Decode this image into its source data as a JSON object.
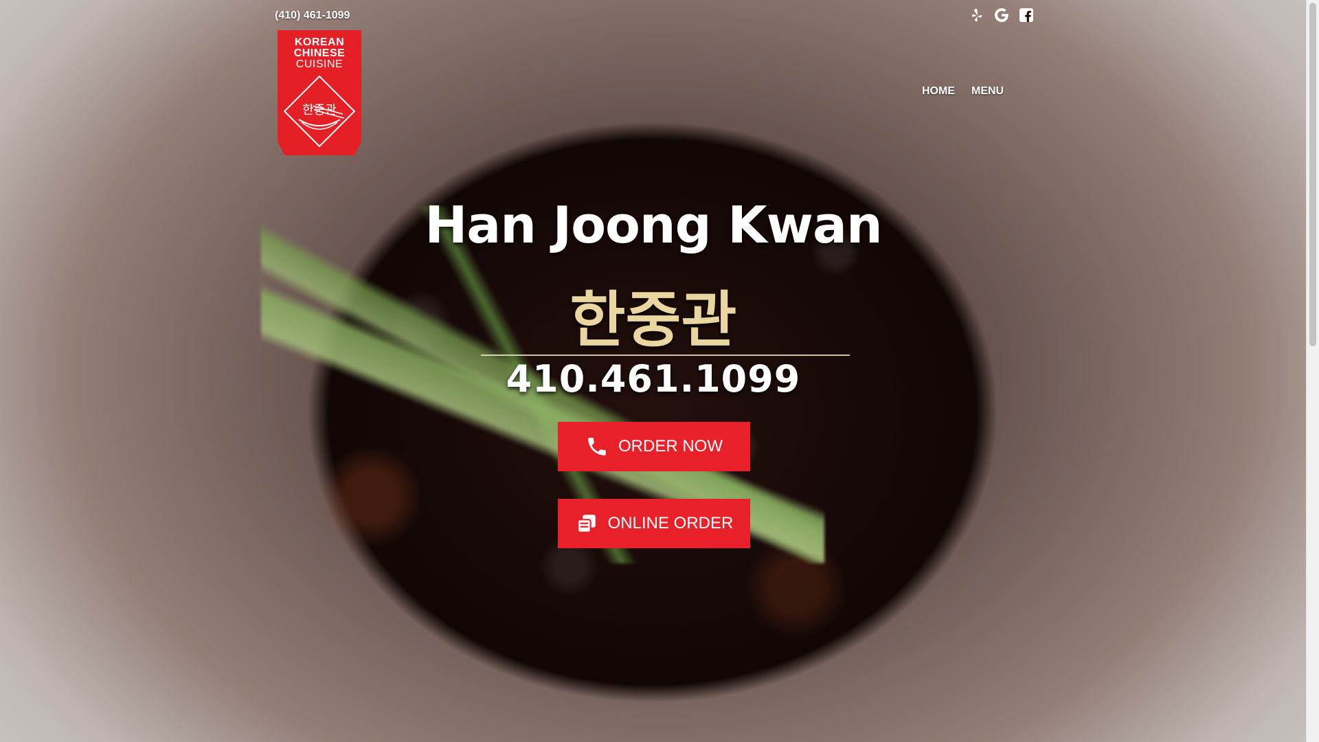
{
  "header": {
    "phone": "(410) 461-1099",
    "social_icons": [
      "yelp-icon",
      "google-icon",
      "facebook-icon"
    ]
  },
  "logo": {
    "line1": "KOREAN",
    "line2": "CHINESE",
    "line3": "CUISINE",
    "korean": "한중관"
  },
  "nav": {
    "items": [
      {
        "label": "HOME"
      },
      {
        "label": "MENU"
      }
    ]
  },
  "hero": {
    "title": "Han Joong Kwan",
    "korean_title": "한중관",
    "phone": "410.461.1099",
    "order_now_label": "ORDER NOW",
    "online_order_label": "ONLINE ORDER",
    "order_now_icon": "phone-icon",
    "online_order_icon": "copy-icon"
  },
  "colors": {
    "accent": "#e8202a",
    "gold": "#ead6a0",
    "text": "#ffffff"
  }
}
